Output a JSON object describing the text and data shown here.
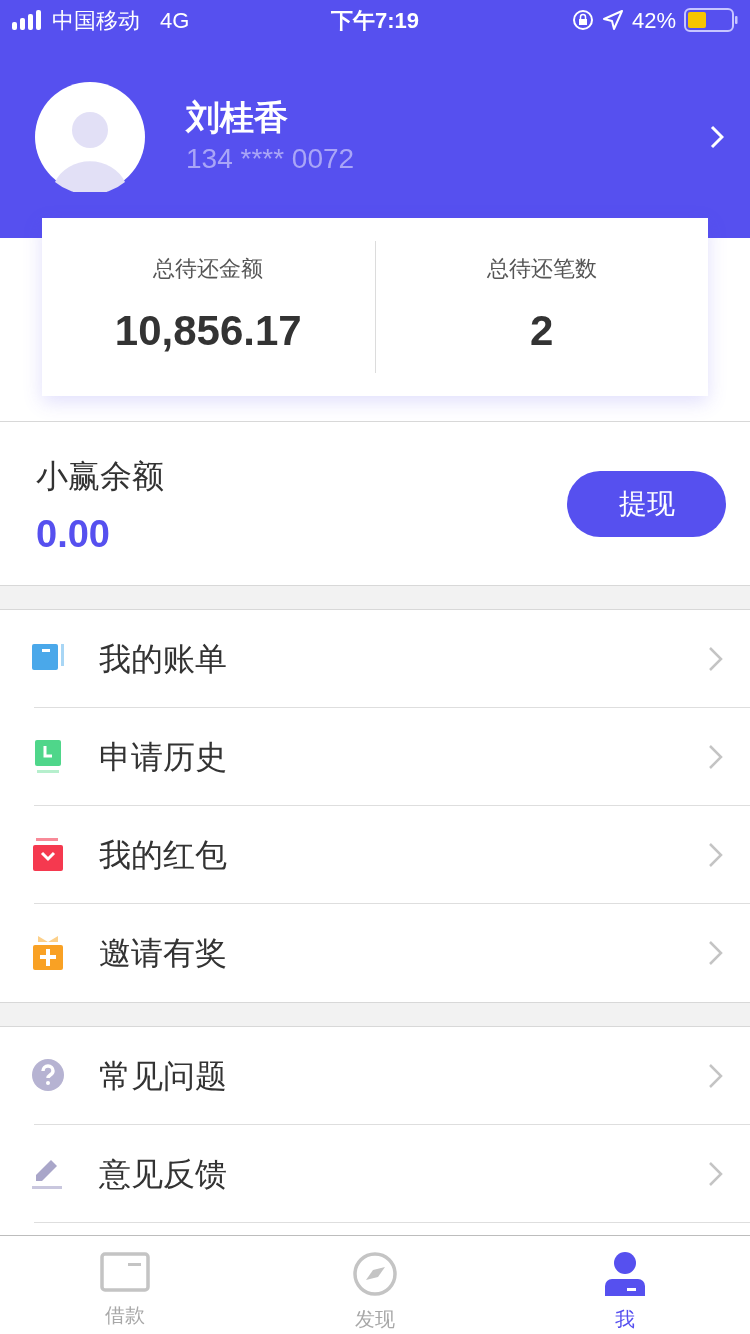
{
  "status_bar": {
    "carrier": "中国移动",
    "network": "4G",
    "time": "下午7:19",
    "battery": "42%"
  },
  "profile": {
    "name": "刘桂香",
    "phone": "134 **** 0072"
  },
  "summary": [
    {
      "label": "总待还金额",
      "value": "10,856.17"
    },
    {
      "label": "总待还笔数",
      "value": "2"
    }
  ],
  "balance": {
    "label": "小赢余额",
    "value": "0.00",
    "button": "提现"
  },
  "menu_groups": [
    [
      {
        "kind": "bill",
        "label": "我的账单"
      },
      {
        "kind": "history",
        "label": "申请历史"
      },
      {
        "kind": "redpacket",
        "label": "我的红包"
      },
      {
        "kind": "invite",
        "label": "邀请有奖"
      }
    ],
    [
      {
        "kind": "faq",
        "label": "常见问题"
      },
      {
        "kind": "feedback",
        "label": "意见反馈"
      }
    ]
  ],
  "tabs": [
    {
      "kind": "loan",
      "label": "借款",
      "selected": false
    },
    {
      "kind": "discover",
      "label": "发现",
      "selected": false
    },
    {
      "kind": "me",
      "label": "我",
      "selected": true
    }
  ]
}
